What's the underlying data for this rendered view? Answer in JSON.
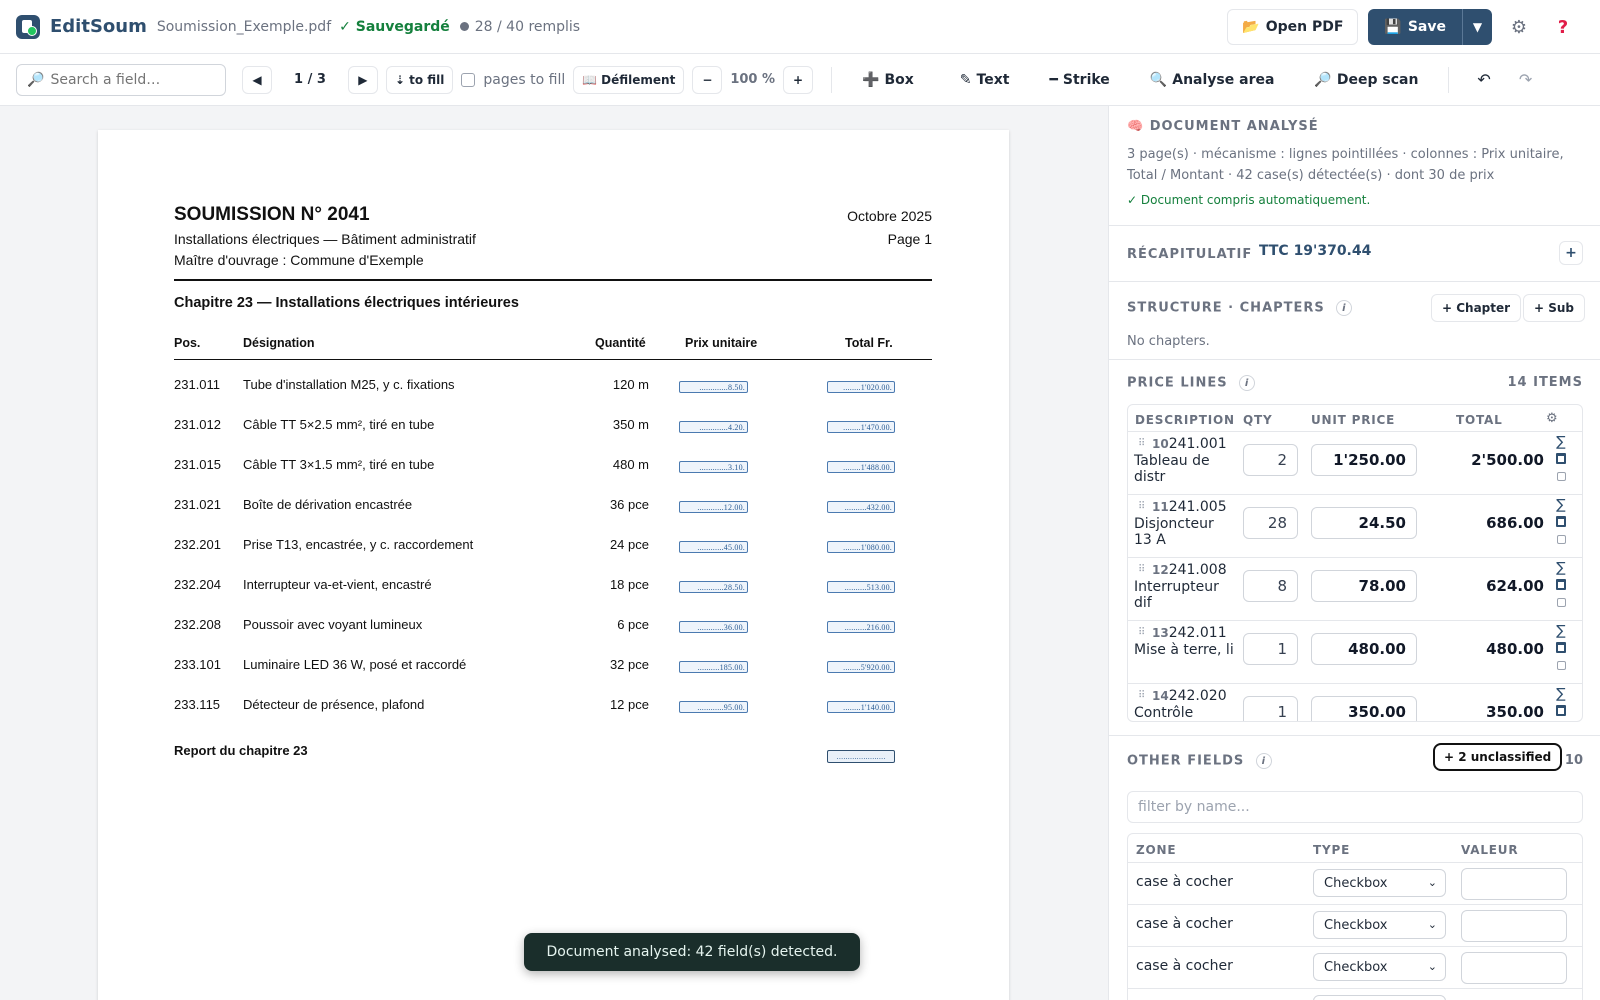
{
  "header": {
    "app_name": "EditSoum",
    "file_name": "Soumission_Exemple.pdf",
    "saved_label": "✓ Sauvegardé",
    "fill_status": "28 / 40 remplis",
    "open_pdf_label": "Open PDF",
    "save_label": "Save",
    "accent_color": "#2f4f6f"
  },
  "toolbar": {
    "search_placeholder": "Search a field…",
    "page_indicator": "1 / 3",
    "to_fill_label": "⇣ to fill",
    "pages_to_fill_label": "pages to fill",
    "scroll_label": "Défilement",
    "zoom": "100 %",
    "tools": {
      "box": "Box",
      "text": "Text",
      "strike": "Strike",
      "analyse": "Analyse area",
      "deep_scan": "Deep scan"
    }
  },
  "document": {
    "title": "SOUMISSION N° 2041",
    "subtitle1": "Installations électriques — Bâtiment administratif",
    "subtitle2": "Maître d'ouvrage : Commune d'Exemple",
    "date": "Octobre 2025",
    "page": "Page 1",
    "chapter": "Chapitre 23 — Installations électriques intérieures",
    "columns": {
      "pos": "Pos.",
      "designation": "Désignation",
      "quantity": "Quantité",
      "unit_price": "Prix unitaire",
      "total": "Total Fr."
    },
    "rows": [
      {
        "pos": "231.011",
        "designation": "Tube d'installation M25, y c. fixations",
        "qty": "120 m",
        "unit": ".............8.50.",
        "total": "........1'020.00."
      },
      {
        "pos": "231.012",
        "designation": "Câble TT 5×2.5 mm², tiré en tube",
        "qty": "350 m",
        "unit": ".............4.20.",
        "total": "........1'470.00."
      },
      {
        "pos": "231.015",
        "designation": "Câble TT 3×1.5 mm², tiré en tube",
        "qty": "480 m",
        "unit": ".............3.10.",
        "total": "........1'488.00."
      },
      {
        "pos": "231.021",
        "designation": "Boîte de dérivation encastrée",
        "qty": "36 pce",
        "unit": "............12.00.",
        "total": "..........432.00."
      },
      {
        "pos": "232.201",
        "designation": "Prise T13, encastrée, y c. raccordement",
        "qty": "24 pce",
        "unit": "............45.00.",
        "total": "........1'080.00."
      },
      {
        "pos": "232.204",
        "designation": "Interrupteur va-et-vient, encastré",
        "qty": "18 pce",
        "unit": "............28.50.",
        "total": "..........513.00."
      },
      {
        "pos": "232.208",
        "designation": "Poussoir avec voyant lumineux",
        "qty": "6 pce",
        "unit": "............36.00.",
        "total": "..........216.00."
      },
      {
        "pos": "233.101",
        "designation": "Luminaire LED 36 W, posé et raccordé",
        "qty": "32 pce",
        "unit": "..........185.00.",
        "total": "........5'920.00."
      },
      {
        "pos": "233.115",
        "designation": "Détecteur de présence, plafond",
        "qty": "12 pce",
        "unit": "............95.00.",
        "total": "........1'140.00."
      }
    ],
    "report_label": "Report du chapitre 23",
    "report_value": "......................"
  },
  "toast": "Document analysed: 42 field(s) detected.",
  "panel": {
    "analysis": {
      "title": "DOCUMENT ANALYSÉ",
      "text": "3 page(s) · mécanisme : lignes pointillées · colonnes : Prix unitaire, Total / Montant · 42 case(s) détectée(s) · dont 30 de prix",
      "ok": "✓ Document compris automatiquement."
    },
    "recap": {
      "title": "RÉCAPITULATIF",
      "value": "TTC 19'370.44"
    },
    "structure": {
      "title": "STRUCTURE · CHAPTERS",
      "add_chapter": "+ Chapter",
      "add_sub": "+ Sub",
      "empty": "No chapters."
    },
    "price_lines": {
      "title": "PRICE LINES",
      "count": "14 ITEMS",
      "columns": {
        "description": "DESCRIPTION",
        "qty": "QTY",
        "unit_price": "UNIT PRICE",
        "total": "TOTAL"
      },
      "rows": [
        {
          "num": "10",
          "code": "241.001",
          "desc": "Tableau de distr",
          "qty": "2",
          "unit": "1'250.00",
          "total": "2'500.00"
        },
        {
          "num": "11",
          "code": "241.005",
          "desc": "Disjoncteur 13 A",
          "qty": "28",
          "unit": "24.50",
          "total": "686.00"
        },
        {
          "num": "12",
          "code": "241.008",
          "desc": "Interrupteur dif",
          "qty": "8",
          "unit": "78.00",
          "total": "624.00"
        },
        {
          "num": "13",
          "code": "242.011",
          "desc": "Mise à terre, li",
          "qty": "1",
          "unit": "480.00",
          "total": "480.00"
        },
        {
          "num": "14",
          "code": "242.020",
          "desc": "Contrôle",
          "qty": "1",
          "unit": "350.00",
          "total": "350.00"
        }
      ]
    },
    "other_fields": {
      "title": "OTHER FIELDS",
      "unclassified": "+ 2 unclassified",
      "count": "10",
      "filter_placeholder": "filter by name...",
      "columns": {
        "zone": "ZONE",
        "type": "TYPE",
        "value": "VALEUR"
      },
      "rows": [
        {
          "zone": "case à cocher",
          "type": "Checkbox"
        },
        {
          "zone": "case à cocher",
          "type": "Checkbox"
        },
        {
          "zone": "case à cocher",
          "type": "Checkbox"
        }
      ]
    }
  }
}
